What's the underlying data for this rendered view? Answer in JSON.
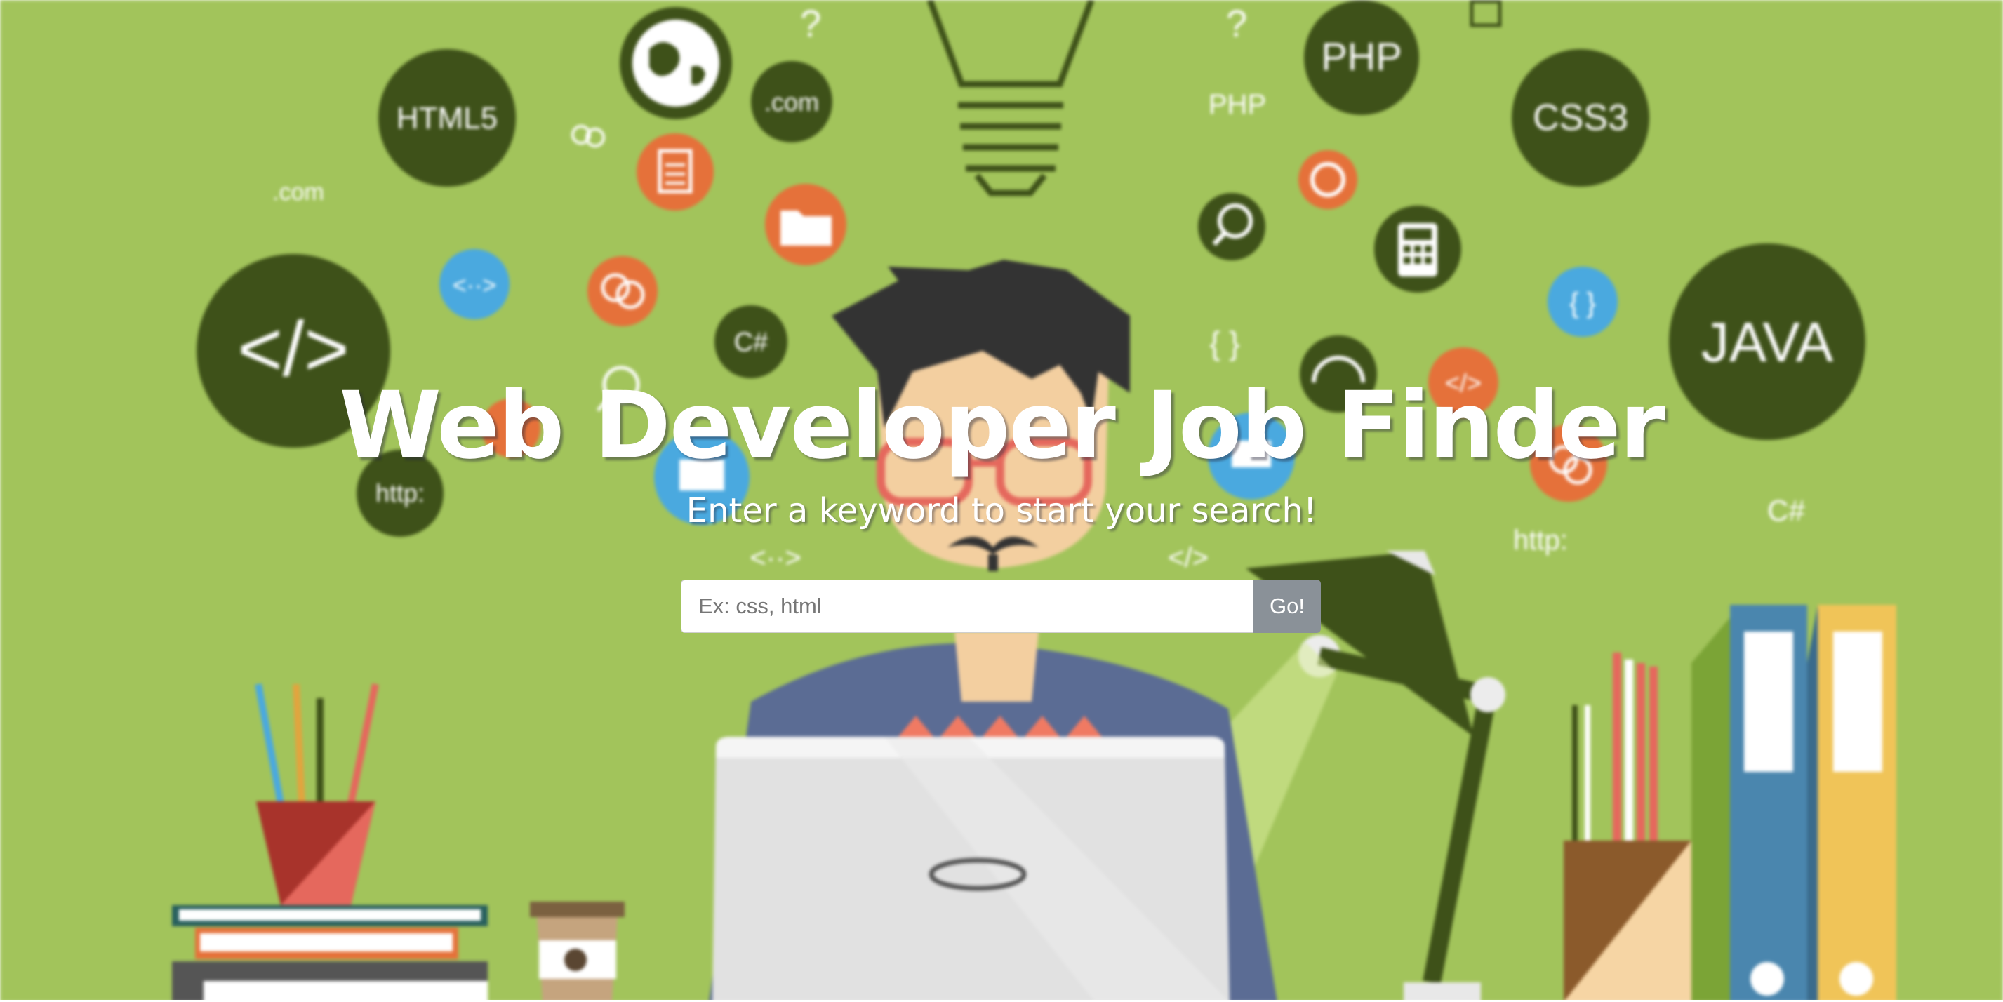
{
  "header": {
    "title": "Web Developer Job Finder",
    "subtitle": "Enter a keyword to start your search!"
  },
  "search": {
    "placeholder": "Ex: css, html",
    "value": "",
    "button_label": "Go!"
  },
  "illustration": {
    "labels": {
      "html5": "HTML5",
      "php": "PHP",
      "php_small": "PHP",
      "css3": "CSS3",
      "java": "JAVA",
      "com1": ".com",
      "com2": ".com",
      "http1": "http:",
      "http2": "http:",
      "csharp1": "C#",
      "csharp2": "C#",
      "code_tag": "</>",
      "code_tag_small": "</>",
      "code_tag_orange": "</>",
      "arrows1": "<··>",
      "arrows2": "<··>",
      "braces1": "{ }",
      "braces2": "{ }",
      "question1": "?",
      "question2": "?"
    },
    "colors": {
      "background": "#a2c45b",
      "dark_circle": "#3e5119",
      "orange": "#e5713a",
      "blue": "#4aa9df",
      "skin": "#f3cfa0",
      "hair": "#333333",
      "shirt": "#5b6c94"
    }
  }
}
